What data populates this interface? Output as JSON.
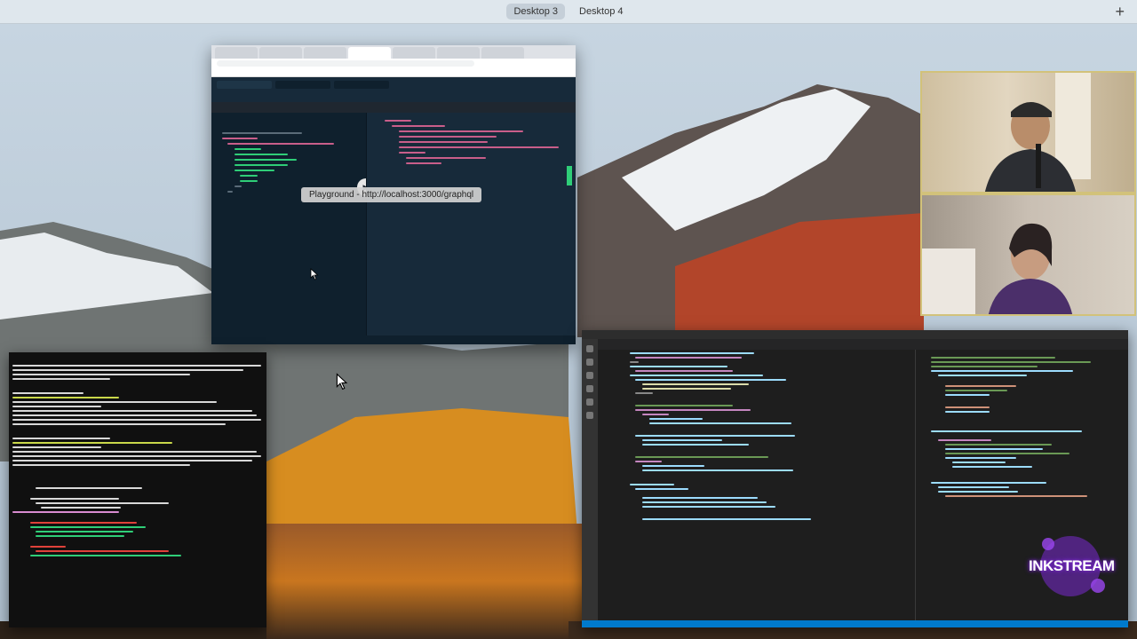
{
  "desktops": {
    "tabs": [
      {
        "label": "Desktop 3",
        "active": true
      },
      {
        "label": "Desktop 4",
        "active": false
      }
    ],
    "add_icon": "plus-icon"
  },
  "browser_window": {
    "tooltip": "Playground - http://localhost:3000/graphql"
  },
  "overlay_logo": {
    "text": "INKSTREAM"
  },
  "colors": {
    "accent_green": "#2fce78",
    "vscode_status": "#007acc",
    "cam_border": "#d2c27a",
    "logo_glow": "#7a2ad0"
  }
}
